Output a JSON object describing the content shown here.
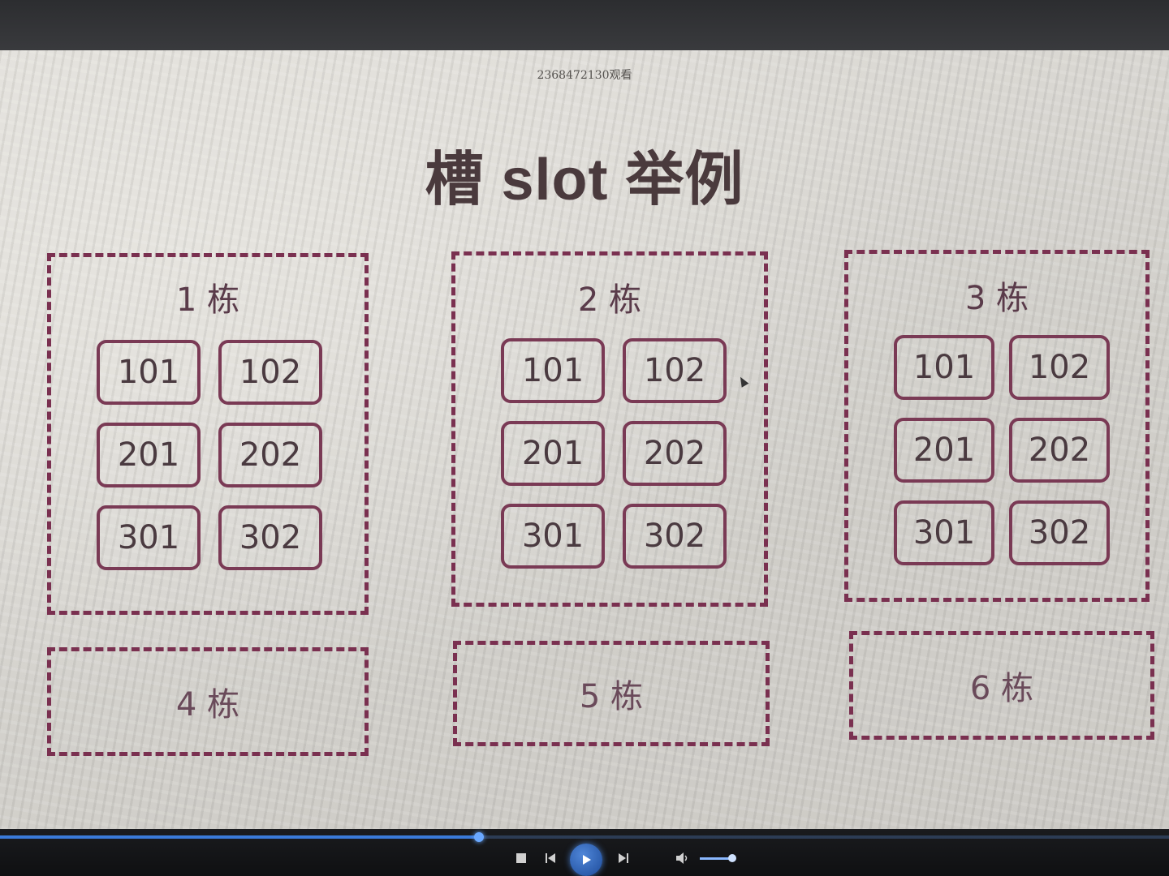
{
  "watermark": "2368472130观看",
  "slide": {
    "title": "槽 slot 举例"
  },
  "buildings": [
    {
      "label": "1 栋",
      "rooms": [
        "101",
        "102",
        "201",
        "202",
        "301",
        "302"
      ]
    },
    {
      "label": "2 栋",
      "rooms": [
        "101",
        "102",
        "201",
        "202",
        "301",
        "302"
      ]
    },
    {
      "label": "3 栋",
      "rooms": [
        "101",
        "102",
        "201",
        "202",
        "301",
        "302"
      ]
    }
  ],
  "small_buildings": [
    {
      "label": "4 栋"
    },
    {
      "label": "5 栋"
    },
    {
      "label": "6 栋"
    }
  ],
  "player": {
    "progress": 0.41,
    "volume": 0.9,
    "icons": [
      "stop-icon",
      "previous-icon",
      "play-icon",
      "next-icon",
      "volume-icon"
    ]
  },
  "colors": {
    "border": "#7a3050",
    "title": "#4a3a3d",
    "accent": "#3a7ad9"
  }
}
